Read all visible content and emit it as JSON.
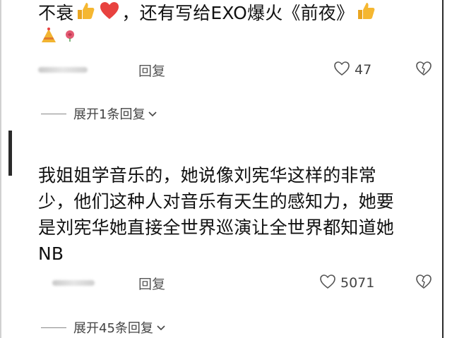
{
  "top_comment": {
    "text_part1": "不衰",
    "text_part2": "，还有写给EXO爆火《前夜》",
    "emojis": [
      "thumbs-up-icon",
      "heart-icon",
      "thumbs-up-icon",
      "party-hat-icon",
      "rose-icon"
    ],
    "reply_label": "回复",
    "like_count": "47"
  },
  "thread_1": {
    "expand_label": "展开1条回复"
  },
  "main_comment": {
    "text": "我姐姐学音乐的，她说像刘宪华这样的非常少，他们这种人对音乐有天生的感知力，她要是刘宪华她直接全世界巡演让全世界都知道她NB",
    "reply_label": "回复",
    "like_count": "5071"
  },
  "thread_2": {
    "expand_label": "展开45条回复"
  },
  "colors": {
    "thumb": "#f5b731",
    "heart": "#e8423f",
    "text": "#111111",
    "muted": "#555555"
  }
}
